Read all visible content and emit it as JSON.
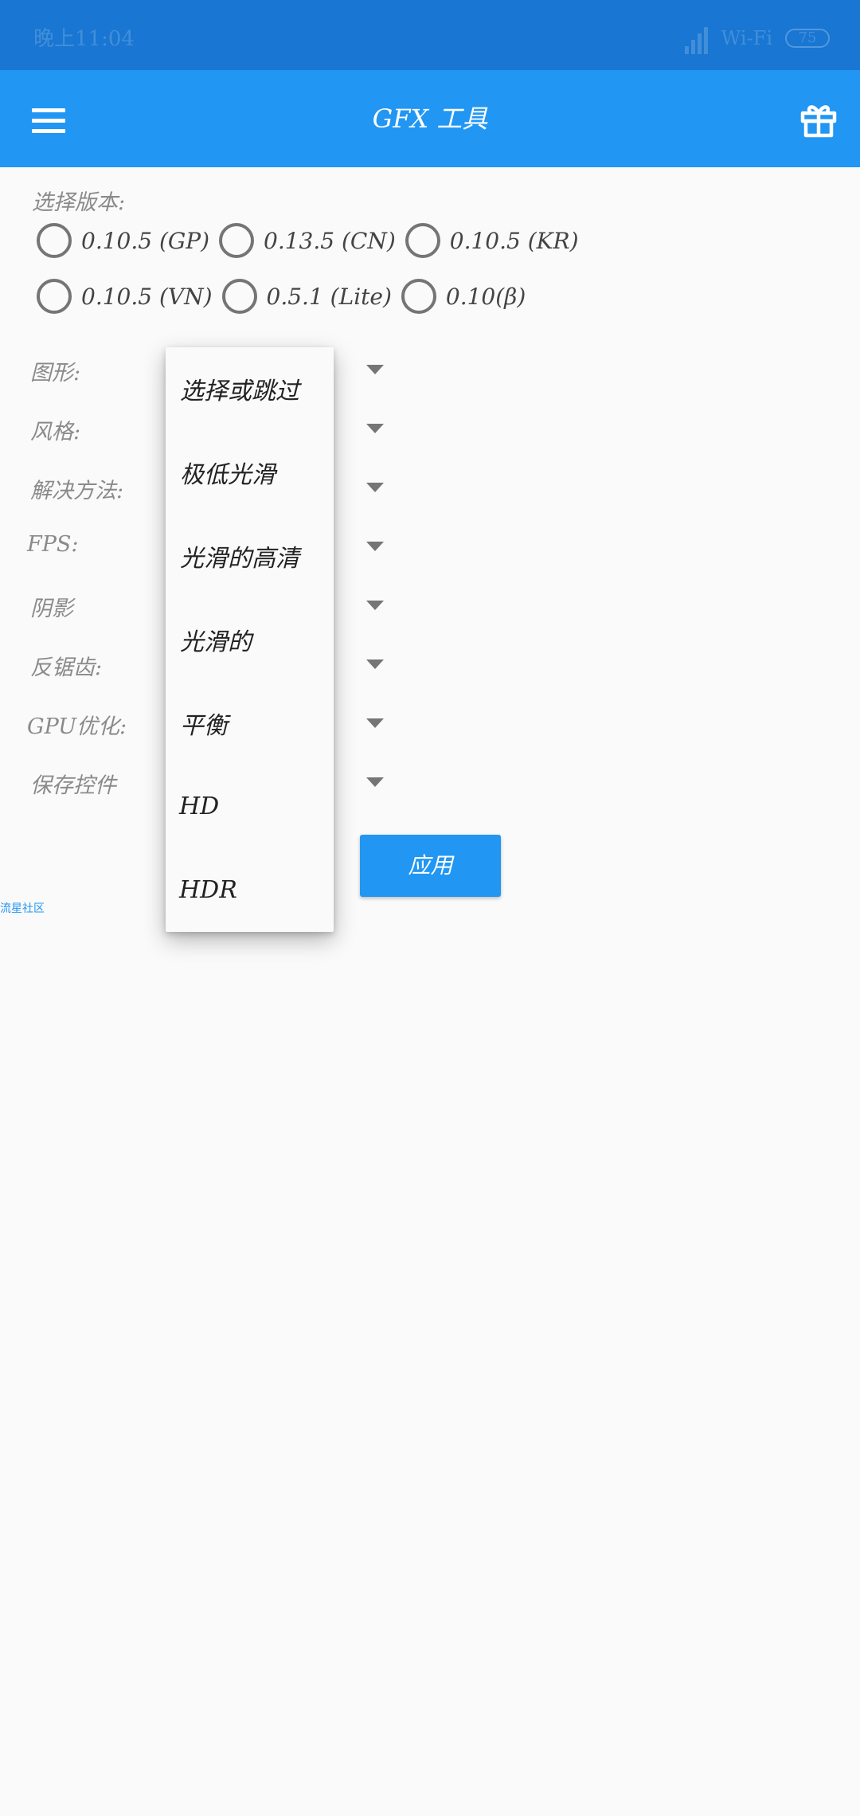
{
  "status_bar": {
    "time": "晚上11:04",
    "wifi": "Wi-Fi",
    "battery": "75"
  },
  "app_bar": {
    "title": "GFX 工具",
    "menu_icon": "menu-icon",
    "gift_icon": "gift-icon"
  },
  "version": {
    "label": "选择版本:",
    "rows": [
      [
        "0.10.5 (GP)",
        "0.13.5 (CN)",
        "0.10.5 (KR)"
      ],
      [
        "0.10.5 (VN)",
        "0.5.1 (Lite)",
        "0.10(β)"
      ]
    ]
  },
  "settings": {
    "graphics": "图形:",
    "style": "风格:",
    "resolution": "解决方法:",
    "fps": "FPS:",
    "shadow": "阴影",
    "antialias": "反锯齿:",
    "gpu": "GPU优化:",
    "save_controls": "保存控件"
  },
  "dropdown": {
    "items": [
      "选择或跳过",
      "极低光滑",
      "光滑的高清",
      "光滑的",
      "平衡",
      "HD",
      "HDR"
    ]
  },
  "apply_label": "应用",
  "community_link": "流星社区",
  "colors": {
    "status_bar": "#1976d2",
    "app_bar": "#2196f3",
    "button": "#2196f3"
  }
}
